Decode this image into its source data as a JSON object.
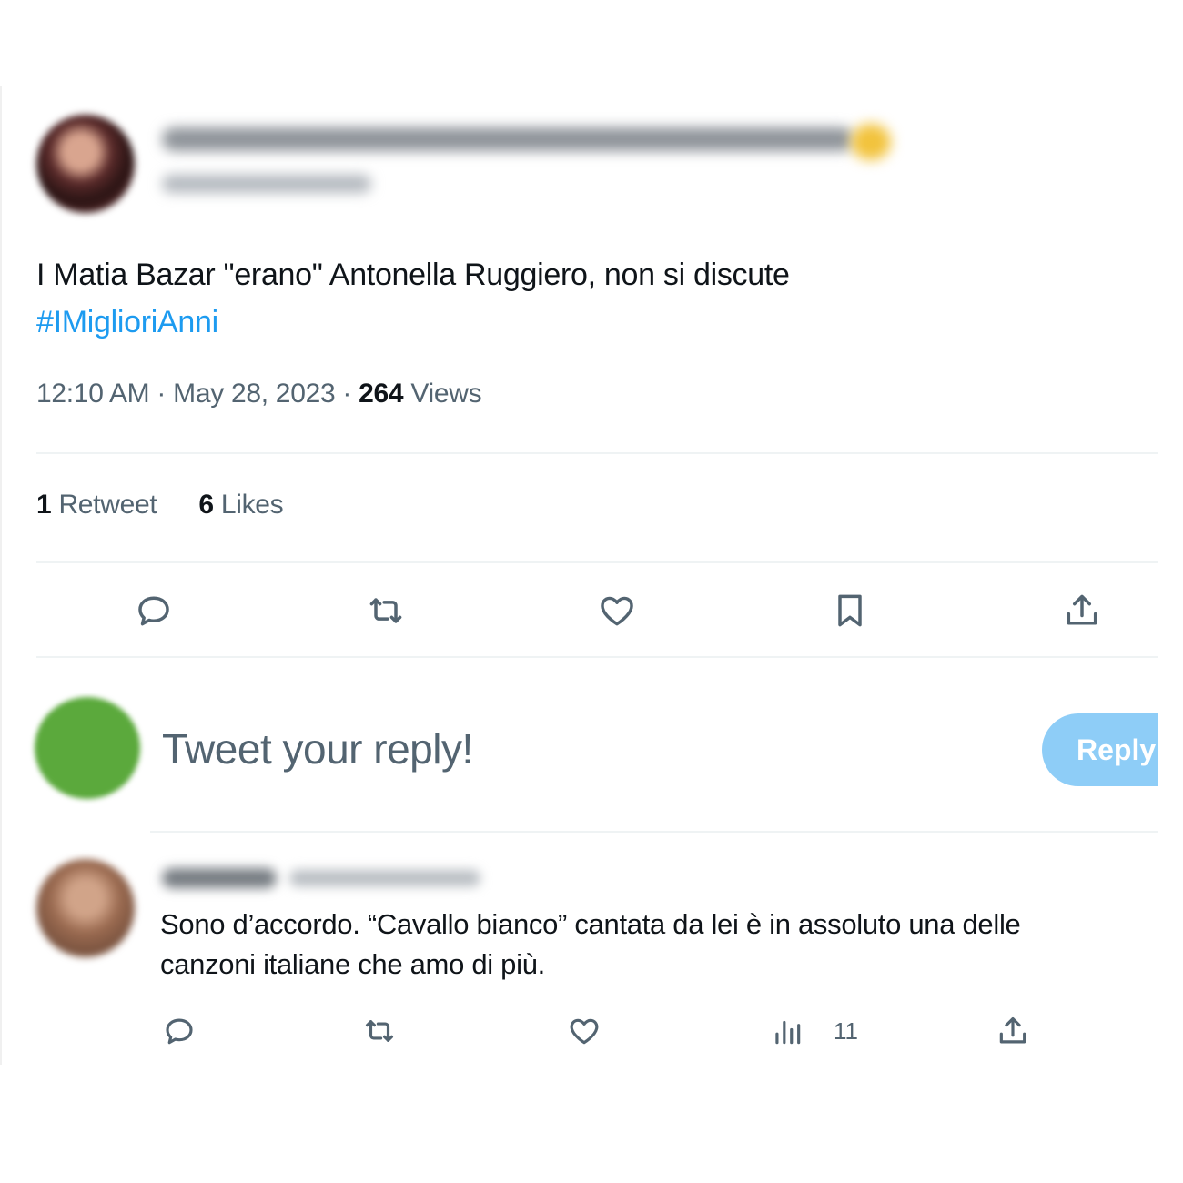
{
  "tweet": {
    "text": "I Matia Bazar \"erano\" Antonella Ruggiero, non si discute",
    "hashtag": "#IMiglioriAnni",
    "time": "12:10 AM",
    "date": "May 28, 2023",
    "views_count": "264",
    "views_label": "Views",
    "separator": "·"
  },
  "stats": {
    "retweets_count": "1",
    "retweets_label": "Retweet",
    "likes_count": "6",
    "likes_label": "Likes"
  },
  "actions": {
    "icons": [
      "reply-icon",
      "retweet-icon",
      "like-icon",
      "bookmark-icon",
      "share-icon"
    ]
  },
  "composer": {
    "placeholder": "Tweet your reply!",
    "button_label": "Reply"
  },
  "comment": {
    "text_line1": "Sono d’accordo. “Cavallo bianco” cantata da lei è in assoluto una delle",
    "text_line2": "canzoni italiane che amo di più.",
    "views_count": "11",
    "icons": [
      "reply-icon",
      "retweet-icon",
      "like-icon",
      "views-icon",
      "share-icon"
    ]
  },
  "colors": {
    "accent": "#1d9bf0",
    "reply_button": "#8ecdf7",
    "secondary_text": "#536471",
    "primary_text": "#0f1419",
    "divider": "#eff3f4",
    "composer_avatar": "#5ba93c"
  }
}
